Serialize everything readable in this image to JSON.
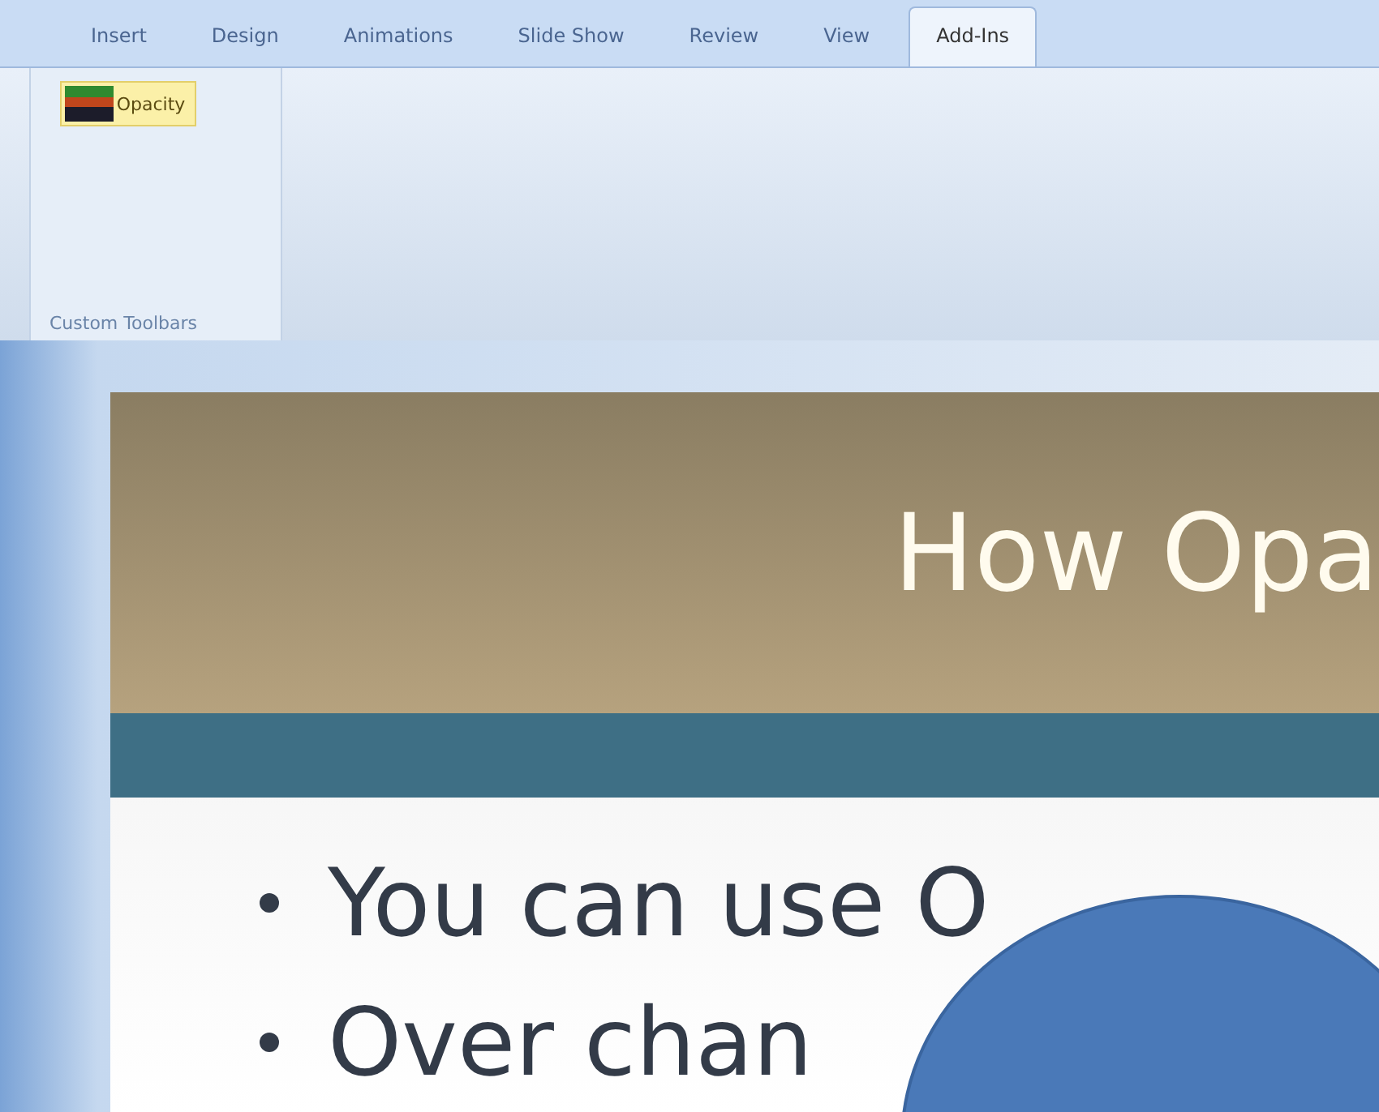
{
  "tabs": [
    {
      "label": "Insert",
      "selected": false
    },
    {
      "label": "Design",
      "selected": false
    },
    {
      "label": "Animations",
      "selected": false
    },
    {
      "label": "Slide Show",
      "selected": false
    },
    {
      "label": "Review",
      "selected": false
    },
    {
      "label": "View",
      "selected": false
    },
    {
      "label": "Add-Ins",
      "selected": true
    }
  ],
  "ribbon": {
    "group": {
      "label": "Custom Toolbars",
      "buttons": [
        {
          "label": "Opacity"
        }
      ]
    }
  },
  "slide": {
    "title": "How Opa",
    "bullets": [
      "You can use O",
      "Over chan"
    ]
  }
}
